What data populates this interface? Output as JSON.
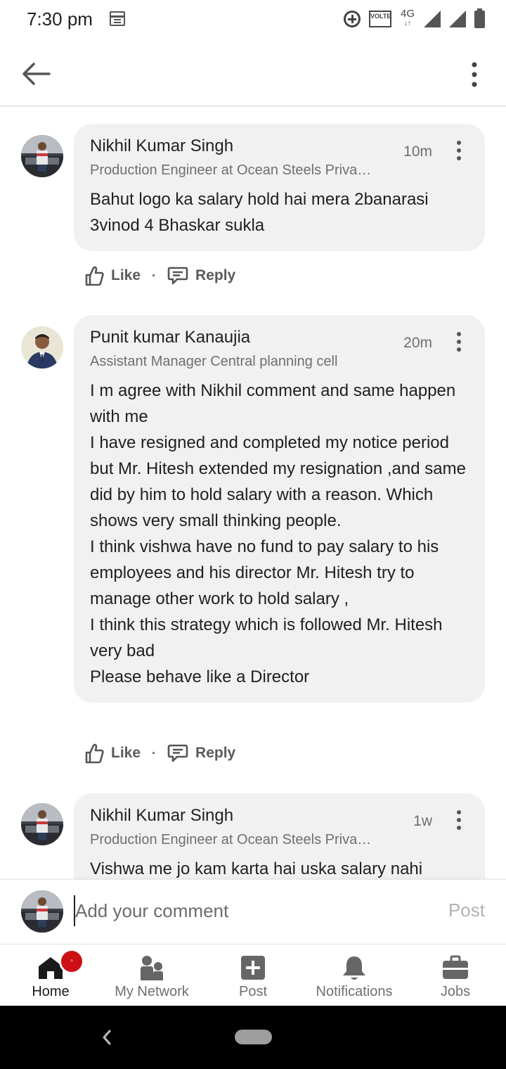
{
  "status_bar": {
    "time": "7:30 pm",
    "volte": "VOLTE",
    "network": "4G"
  },
  "app_bar": {
    "back_icon": "arrow-left-icon",
    "menu_icon": "more-vertical-icon"
  },
  "comments": [
    {
      "author": "Nikhil Kumar Singh",
      "headline": "Production Engineer at Ocean Steels Private Limited",
      "time": "10m",
      "text": [
        "Bahut logo ka salary hold hai mera 2banarasi 3vinod 4 Bhaskar sukla"
      ],
      "like_label": "Like",
      "reply_label": "Reply",
      "separator": "·"
    },
    {
      "author": "Punit kumar Kanaujia",
      "headline": "Assistant Manager Central planning cell",
      "time": "20m",
      "text": [
        "I m agree with Nikhil comment and same happen with me",
        "I have resigned and completed my notice period but Mr. Hitesh extended my resignation ,and same did by him to hold salary with a reason. Which shows very small thinking people.",
        "I think vishwa have no fund to pay salary to his employees and his director Mr. Hitesh try to manage other work to hold salary ,",
        "I think this strategy which is followed Mr. Hitesh very bad",
        "Please behave like a Director"
      ],
      "like_label": "Like",
      "reply_label": "Reply",
      "separator": "·"
    },
    {
      "author": "Nikhil Kumar Singh",
      "headline": "Production Engineer at Ocean Steels Private Limited",
      "time": "1w",
      "text": [
        "Vishwa me jo kam karta hai uska salary nahi"
      ]
    }
  ],
  "comment_input": {
    "placeholder": "Add your comment",
    "post_label": "Post"
  },
  "bottom_nav": {
    "items": [
      {
        "label": "Home",
        "icon": "home-icon",
        "active": true
      },
      {
        "label": "My Network",
        "icon": "people-icon"
      },
      {
        "label": "Post",
        "icon": "plus-square-icon"
      },
      {
        "label": "Notifications",
        "icon": "bell-icon"
      },
      {
        "label": "Jobs",
        "icon": "briefcase-icon"
      }
    ],
    "home_badge": "▫"
  },
  "colors": {
    "bubble": "#f1f1f1",
    "badge": "#cc1016",
    "muted_text": "#6f6f6f"
  }
}
